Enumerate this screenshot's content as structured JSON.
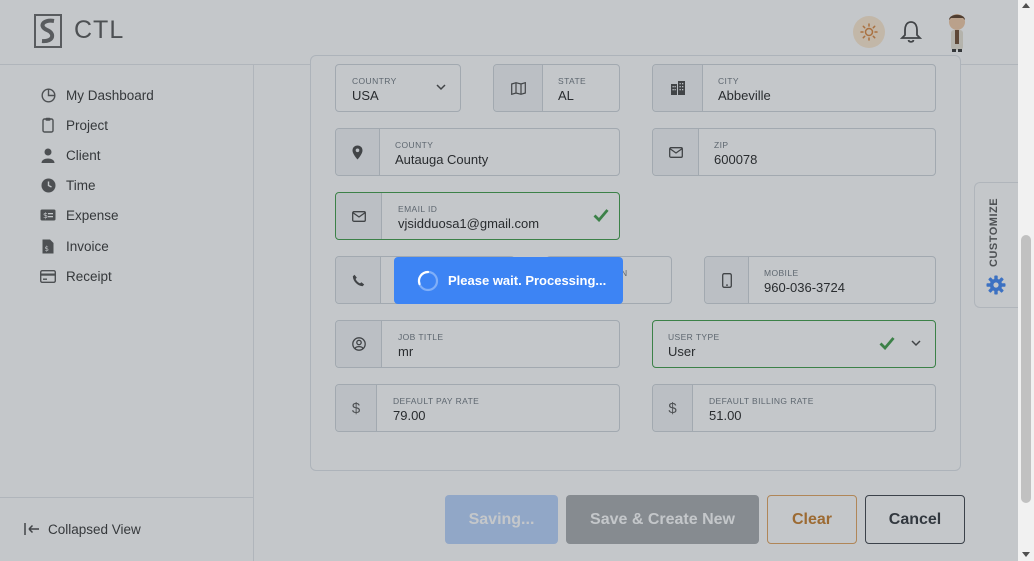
{
  "header": {
    "logo_text": "CTL",
    "icons": {
      "theme": "sun-icon",
      "notifications": "bell-icon",
      "avatar": "user-avatar"
    }
  },
  "sidebar": {
    "items": [
      {
        "label": "My Dashboard",
        "icon": "dashboard-icon"
      },
      {
        "label": "Project",
        "icon": "clipboard-icon"
      },
      {
        "label": "Client",
        "icon": "person-icon"
      },
      {
        "label": "Time",
        "icon": "clock-icon"
      },
      {
        "label": "Expense",
        "icon": "money-icon"
      },
      {
        "label": "Invoice",
        "icon": "invoice-icon"
      },
      {
        "label": "Receipt",
        "icon": "receipt-icon"
      }
    ],
    "collapse_label": "Collapsed View"
  },
  "form": {
    "country": {
      "label": "COUNTRY",
      "value": "USA"
    },
    "state": {
      "label": "STATE",
      "value": "AL"
    },
    "city": {
      "label": "CITY",
      "value": "Abbeville"
    },
    "county": {
      "label": "COUNTY",
      "value": "Autauga County"
    },
    "zip": {
      "label": "ZIP",
      "value": "600078"
    },
    "email": {
      "label": "EMAIL ID",
      "value": "vjsidduosa1@gmail.com"
    },
    "ext_fragment": "N",
    "mobile": {
      "label": "MOBILE",
      "value": "960-036-3724"
    },
    "job_title": {
      "label": "JOB TITLE",
      "value": "mr"
    },
    "user_type": {
      "label": "USER TYPE",
      "value": "User"
    },
    "pay_rate": {
      "label": "DEFAULT PAY RATE",
      "value": "79.00",
      "symbol": "$"
    },
    "billing_rate": {
      "label": "DEFAULT BILLING RATE",
      "value": "51.00",
      "symbol": "$"
    }
  },
  "actions": {
    "saving": "Saving...",
    "save_create_new": "Save & Create New",
    "clear": "Clear",
    "cancel": "Cancel"
  },
  "customize": {
    "label": "CUSTOMIZE"
  },
  "overlay": {
    "message": "Please wait. Processing..."
  },
  "colors": {
    "primary": "#3d84f4",
    "success": "#3d9b45",
    "warning_outline": "#e2a35c",
    "theme_badge": "#fde8cf"
  }
}
